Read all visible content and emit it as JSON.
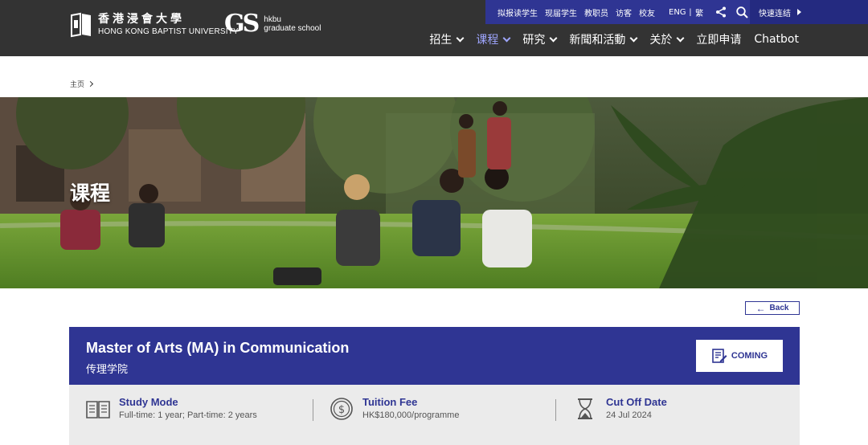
{
  "header": {
    "logo_cn": "香港浸會大學",
    "logo_en": "HONG KONG BAPTIST UNIVERSITY",
    "gs_mark": "GS",
    "gs_line1": "hkbu",
    "gs_line2": "graduate school",
    "topbar_links": [
      "拟报读学生",
      "现届学生",
      "教职员",
      "访客",
      "校友"
    ],
    "lang_eng": "ENG",
    "lang_sep": "|",
    "lang_trad": "繁",
    "quick_links": "快速连结",
    "nav": [
      {
        "label": "招生",
        "dropdown": true,
        "active": false
      },
      {
        "label": "课程",
        "dropdown": true,
        "active": true
      },
      {
        "label": "研究",
        "dropdown": true,
        "active": false
      },
      {
        "label": "新聞和活動",
        "dropdown": true,
        "active": false
      },
      {
        "label": "关於",
        "dropdown": true,
        "active": false
      },
      {
        "label": "立即申请",
        "dropdown": false,
        "active": false
      },
      {
        "label": "Chatbot",
        "dropdown": false,
        "active": false
      }
    ]
  },
  "breadcrumb": {
    "home": "主页"
  },
  "hero": {
    "title": "课程"
  },
  "back_button": {
    "label": "Back"
  },
  "programme": {
    "title": "Master of Arts (MA) in Communication",
    "faculty": "传理学院",
    "status": "COMING"
  },
  "info": {
    "study_mode": {
      "label": "Study Mode",
      "value": "Full-time: 1 year; Part-time: 2 years"
    },
    "tuition_fee": {
      "label": "Tuition Fee",
      "value": "HK$180,000/programme"
    },
    "cut_off": {
      "label": "Cut Off Date",
      "value": "24 Jul 2024"
    }
  },
  "colors": {
    "brand_blue": "#2f3593",
    "header_dark": "#333333",
    "active_nav": "#9fa6ff"
  }
}
